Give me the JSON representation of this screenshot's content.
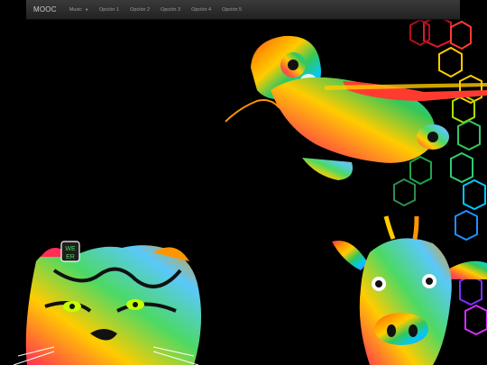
{
  "navbar": {
    "brand": "MOOC",
    "menu": [
      {
        "label": "Music",
        "dropdown": true
      },
      {
        "label": "Opción 1",
        "dropdown": false
      },
      {
        "label": "Opción 2",
        "dropdown": false
      },
      {
        "label": "Opción 3",
        "dropdown": false
      },
      {
        "label": "Opción 4",
        "dropdown": false
      },
      {
        "label": "Opción 5",
        "dropdown": false
      }
    ],
    "caret": "▼"
  },
  "artwork": {
    "items": [
      "chameleon-illustration",
      "tiger-illustration",
      "giraffe-illustration",
      "hexagon-pattern"
    ],
    "badge_text": "WE ER"
  }
}
